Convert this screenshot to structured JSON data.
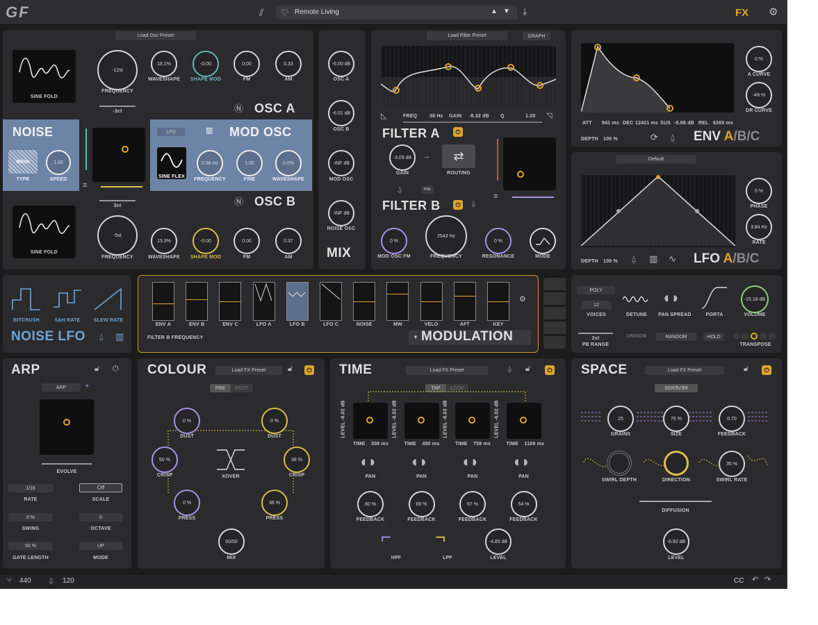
{
  "header": {
    "logo": "GF",
    "preset_name": "Remote Living",
    "fx": "FX"
  },
  "osc": {
    "load_preset": "Load Osc Preset",
    "a": {
      "title": "OSC A",
      "screen": "SINE FOLD",
      "frequency": "-12st",
      "frequency_label": "FREQUENCY",
      "waveshape": "18.1%",
      "waveshape_label": "WAVESHAPE",
      "shape_mod": "-0.00",
      "shape_mod_label": "SHAPE MOD",
      "fm": "0.00",
      "fm_label": "FM",
      "am": "0.33",
      "am_label": "AM",
      "fine": "-3ct"
    },
    "b": {
      "title": "OSC B",
      "screen": "SINE FOLD",
      "frequency": "-5st",
      "frequency_label": "FREQUENCY",
      "waveshape": "15.3%",
      "waveshape_label": "WAVESHAPE",
      "shape_mod": "-0.00",
      "shape_mod_label": "SHAPE MOD",
      "fm": "0.00",
      "fm_label": "FM",
      "am": "0.37",
      "am_label": "AM",
      "fine": "3ct"
    }
  },
  "noise": {
    "title": "NOISE",
    "type": "White",
    "type_label": "TYPE",
    "speed": "1.00",
    "speed_label": "SPEED"
  },
  "modosc": {
    "title": "MOD OSC",
    "lfo": "LFO",
    "screen": "SINE FLEX",
    "frequency": "0.38 Hz",
    "frequency_label": "FREQUENCY",
    "fine": "1.00",
    "fine_label": "FINE",
    "waveshape": "0.0%",
    "waveshape_label": "WAVESHAPE"
  },
  "mix": {
    "title": "MIX",
    "osc_a": "-6.00 dB",
    "osc_a_label": "OSC A",
    "osc_b": "-6.01 dB",
    "osc_b_label": "OSC B",
    "mod_osc": "-INF dB",
    "mod_osc_label": "MOD OSC",
    "noise_osc": "-INF dB",
    "noise_osc_label": "NOISE OSC"
  },
  "filter": {
    "load_preset": "Load Filter Preset",
    "graph": "GRAPH",
    "freq_label": "FREQ",
    "freq": "38 Hz",
    "gain_label": "GAIN",
    "gain": "-8.32 dB",
    "q_label": "Q",
    "q": "1.00",
    "a_title": "FILTER A",
    "b_title": "FILTER B",
    "gain_knob": "-3.09 dB",
    "gain_knob_label": "GAIN",
    "routing_label": "ROUTING",
    "pre": "PRE",
    "mod_osc_fm": "0 %",
    "mod_osc_fm_label": "MOD OSC FM",
    "frequency": "2543 Hz",
    "frequency_label": "FREQUENCY",
    "resonance": "0 %",
    "resonance_label": "RESONANCE",
    "mode_label": "MODE"
  },
  "env": {
    "att_label": "ATT",
    "att": "941 ms",
    "dec_label": "DEC",
    "dec": "12421 ms",
    "sus_label": "SUS",
    "sus": "-5.88 dB",
    "rel_label": "REL",
    "rel": "6265 ms",
    "a_curve": "0 %",
    "a_curve_label": "A CURVE",
    "dr_curve": "-48 %",
    "dr_curve_label": "DR CURVE",
    "depth_label": "DEPTH",
    "depth": "100 %",
    "title_main": "ENV",
    "title_a": "A",
    "title_rest": "/B/C"
  },
  "lfo": {
    "preset": "Default",
    "phase": "0 %",
    "phase_label": "PHASE",
    "rate": "3.84 Hz",
    "rate_label": "RATE",
    "depth_label": "DEPTH",
    "depth": "100 %",
    "title_main": "LFO",
    "title_a": "A",
    "title_rest": "/B/C"
  },
  "noiselfo": {
    "title": "NOISE LFO",
    "bitcrush": "BITCRUSH",
    "sh_rate": "S&H RATE",
    "slew_rate": "SLEW RATE"
  },
  "modulation": {
    "title": "MODULATION",
    "target": "FILTER B FREQUENCY",
    "slots": [
      "ENV A",
      "ENV B",
      "ENV C",
      "LFO A",
      "LFO B",
      "LFO C",
      "NOISE",
      "MW",
      "VELO",
      "AFT",
      "KEY"
    ]
  },
  "voice": {
    "mode": "POLY",
    "voices": "12",
    "voices_label": "VOICES",
    "detune_label": "DETUNE",
    "pan_spread_label": "PAN SPREAD",
    "porta_label": "PORTA",
    "volume": "-15.18 dB",
    "volume_label": "VOLUME",
    "pb": "2st",
    "pb_label": "PB RANGE",
    "unison": "UNISON",
    "random": "RANDOM",
    "hold": "HOLD",
    "transpose_label": "TRANSPOSE"
  },
  "arp": {
    "title": "ARP",
    "mode_sel": "ARP",
    "evolve": "EVOLVE",
    "rate": "1/16",
    "rate_label": "RATE",
    "scale": "Off",
    "scale_label": "SCALE",
    "swing": "0 %",
    "swing_label": "SWING",
    "octave": "0",
    "octave_label": "OCTAVE",
    "gate": "50 %",
    "gate_label": "GATE LENGTH",
    "mode": "UP",
    "mode_label": "MODE"
  },
  "colour": {
    "title": "COLOUR",
    "load_preset": "Load FX Preset",
    "pre": "PRE",
    "post": "POST",
    "dust1": "0 %",
    "dust1_label": "DUST",
    "dust2": "0 %",
    "dust2_label": "DUST",
    "crisp1": "50 %",
    "crisp1_label": "CRISP",
    "crisp2": "38 %",
    "crisp2_label": "CRISP",
    "xover_label": "XOVER",
    "press1": "0 %",
    "press1_label": "PRESS",
    "press2": "36 %",
    "press2_label": "PRESS",
    "mix": "50/50",
    "mix_label": "MIX"
  },
  "time": {
    "title": "TIME",
    "load_preset": "Load FX Preset",
    "tap": "TAP",
    "loop": "LOOP",
    "level_prefix": "LEVEL",
    "taps": [
      {
        "level": "-6.02 dB",
        "time": "308 ms",
        "feedback": "80 %"
      },
      {
        "level": "-6.02 dB",
        "time": "450 ms",
        "feedback": "69 %"
      },
      {
        "level": "-6.02 dB",
        "time": "759 ms",
        "feedback": "67 %"
      },
      {
        "level": "-6.02 dB",
        "time": "1169 ms",
        "feedback": "54 %"
      }
    ],
    "time_label": "TIME",
    "pan_label": "PAN",
    "feedback_label": "FEEDBACK",
    "hpf": "HPF",
    "lpf": "LPF",
    "level": "-4.85 dB",
    "level_label": "LEVEL"
  },
  "space": {
    "title": "SPACE",
    "load_preset": "Load FX Preset",
    "reverse": "REVERSE",
    "grains": "25",
    "grains_label": "GRAINS",
    "size": "76 %",
    "size_label": "SIZE",
    "feedback": "0.70",
    "feedback_label": "FEEDBACK",
    "swirl_depth_label": "SWIRL DEPTH",
    "direction_label": "DIRECTION",
    "swirl_rate": "35 %",
    "swirl_rate_label": "SWIRL RATE",
    "diffusion_label": "DIFFUSION",
    "level": "-6.92 dB",
    "level_label": "LEVEL"
  },
  "footer": {
    "tuning": "440",
    "bpm": "120",
    "cc": "CC"
  }
}
